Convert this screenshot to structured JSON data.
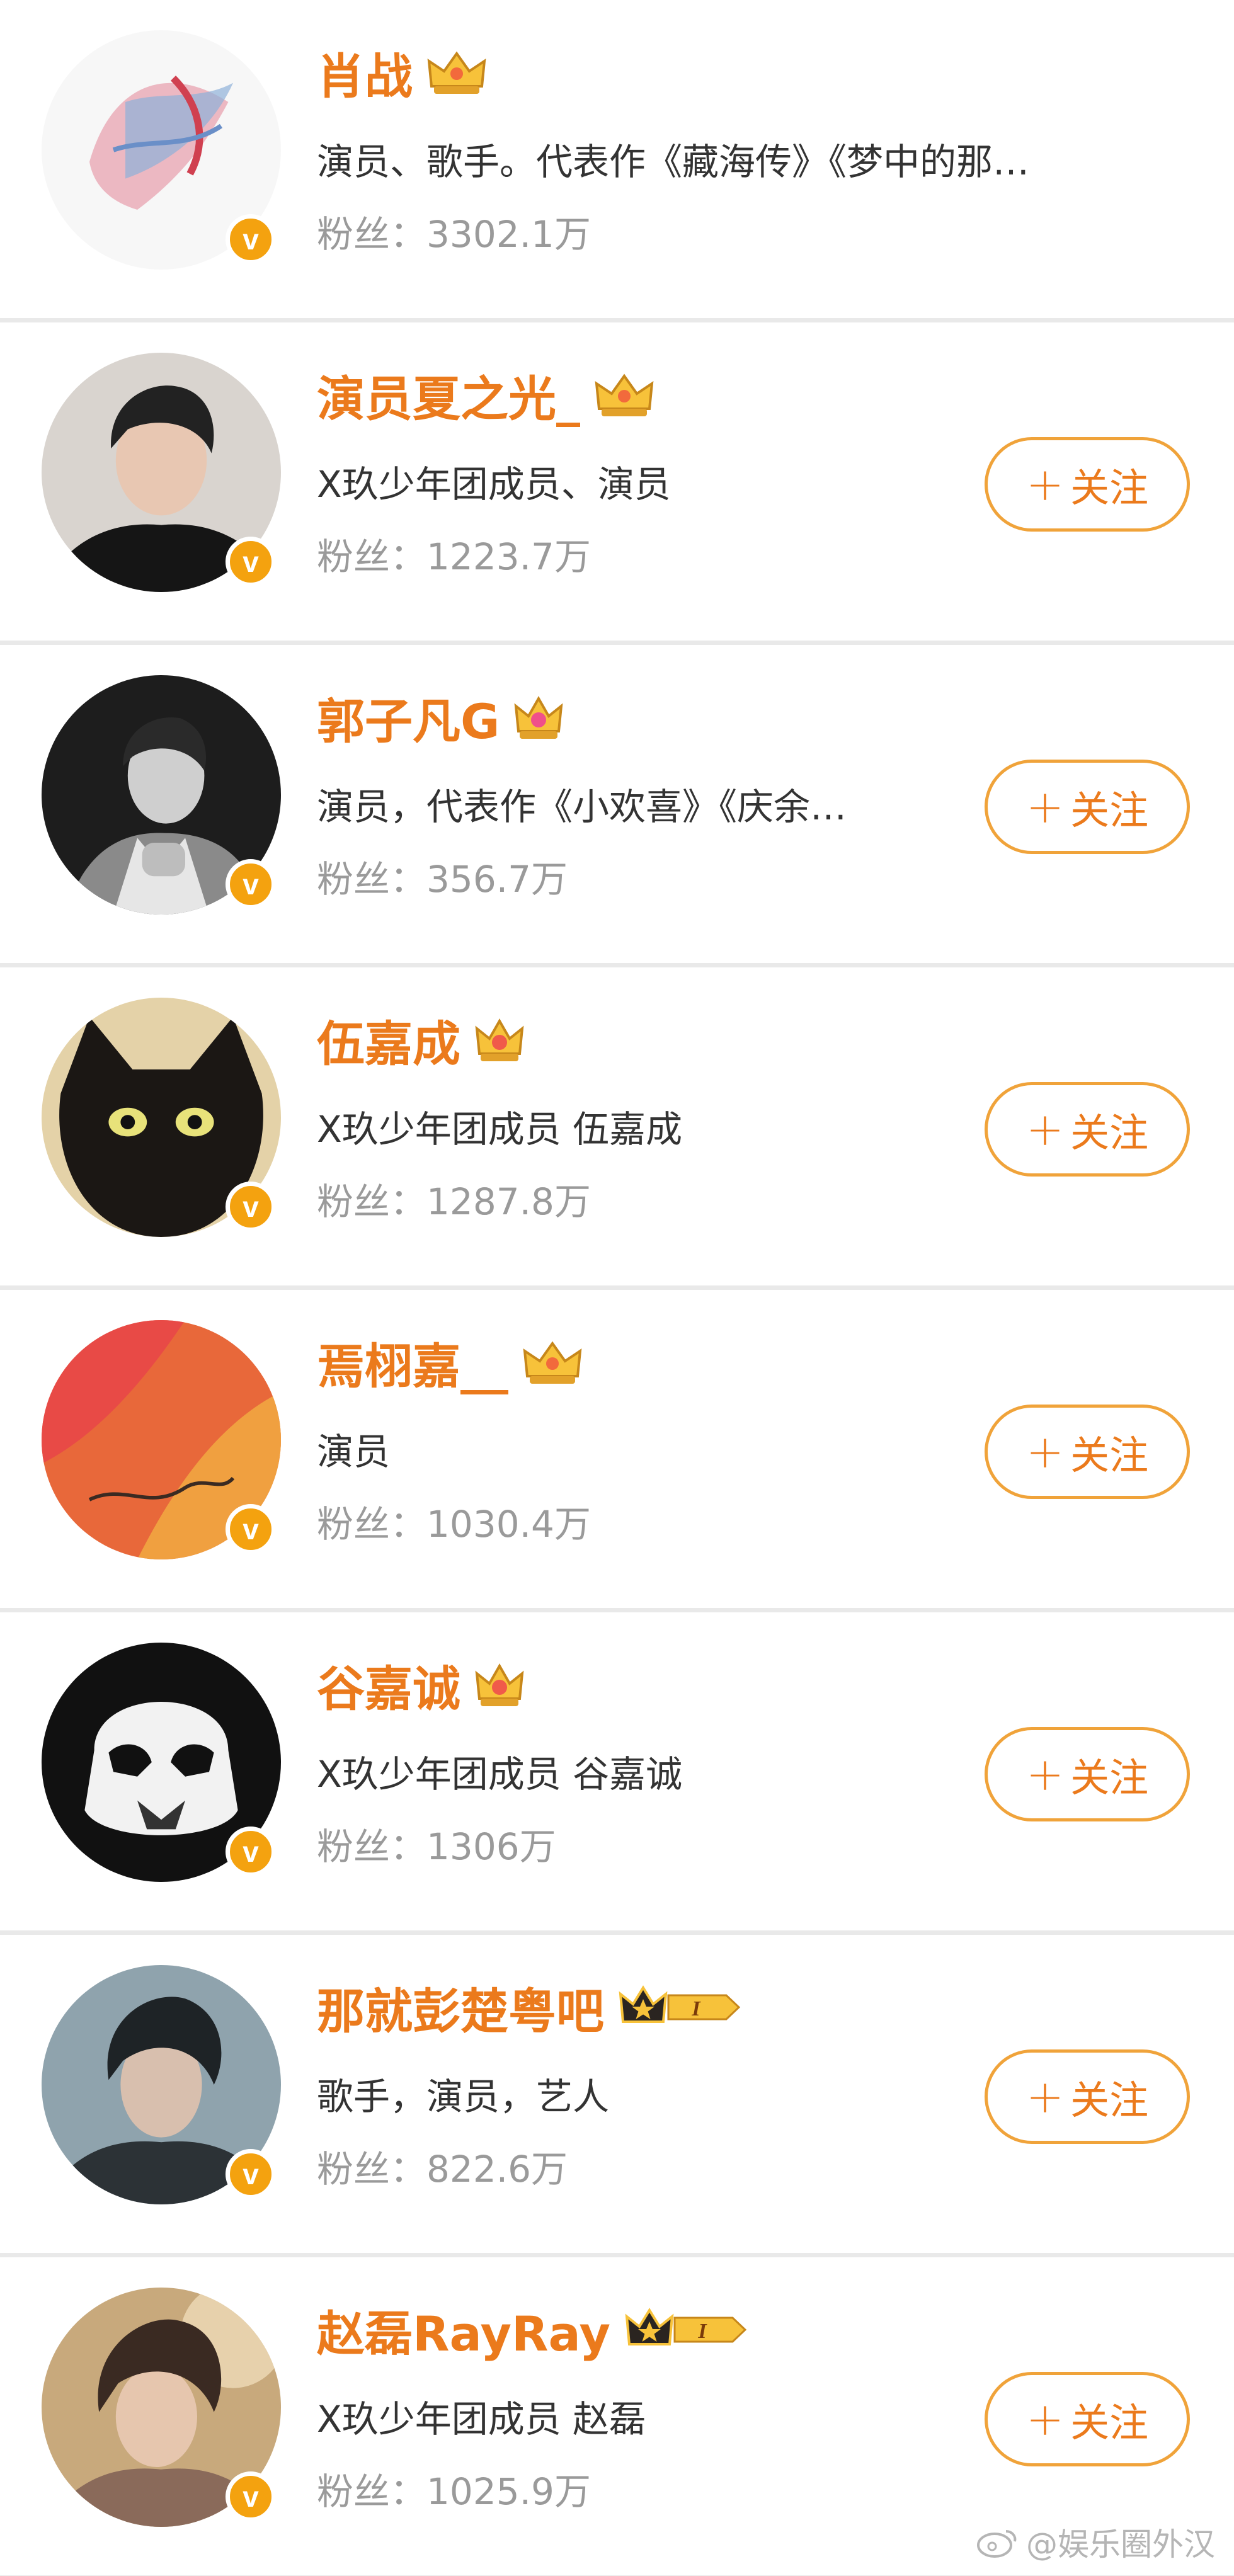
{
  "users": [
    {
      "name": "肖战",
      "badge": "crown-gold-icon",
      "bio": "演员、歌手。代表作《藏海传》《梦中的那…",
      "fans_label": "粉丝：",
      "fans": "3302.1万",
      "follow": null,
      "avatar": "abstract-brush-avatar"
    },
    {
      "name": "演员夏之光_",
      "badge": "crown-gold-icon",
      "bio": "X玖少年团成员、演员",
      "fans_label": "粉丝：",
      "fans": "1223.7万",
      "follow": "关注",
      "avatar": "portrait-avatar"
    },
    {
      "name": "郭子凡G",
      "badge": "crown-gold-icon",
      "bio": "演员，代表作《小欢喜》《庆余…",
      "fans_label": "粉丝：",
      "fans": "356.7万",
      "follow": "关注",
      "avatar": "portrait-bw-avatar"
    },
    {
      "name": "伍嘉成",
      "badge": "crown-gold-icon",
      "bio": "X玖少年团成员 伍嘉成",
      "fans_label": "粉丝：",
      "fans": "1287.8万",
      "follow": "关注",
      "avatar": "black-cat-avatar"
    },
    {
      "name": "焉栩嘉__",
      "badge": "crown-gold-icon",
      "bio": "演员",
      "fans_label": "粉丝：",
      "fans": "1030.4万",
      "follow": "关注",
      "avatar": "orange-painting-avatar"
    },
    {
      "name": "谷嘉诚",
      "badge": "crown-gold-icon",
      "bio": "X玖少年团成员 谷嘉诚",
      "fans_label": "粉丝：",
      "fans": "1306万",
      "follow": "关注",
      "avatar": "stormtrooper-avatar"
    },
    {
      "name": "那就彭楚粤吧",
      "badge": "crown-level-i-icon",
      "bio": "歌手，演员，艺人",
      "fans_label": "粉丝：",
      "fans": "822.6万",
      "follow": "关注",
      "avatar": "portrait-blue-avatar"
    },
    {
      "name": "赵磊RayRay",
      "badge": "crown-level-i-icon",
      "bio": "X玖少年团成员 赵磊",
      "fans_label": "粉丝：",
      "fans": "1025.9万",
      "follow": "关注",
      "avatar": "portrait-warm-avatar"
    }
  ],
  "watermark": "@娱乐圈外汉",
  "level_badge_text": "I",
  "colors": {
    "name": "#eb7a1c",
    "follow_border": "#f0a33a",
    "verified": "#f4a20f",
    "fans": "#9a9a9a"
  }
}
